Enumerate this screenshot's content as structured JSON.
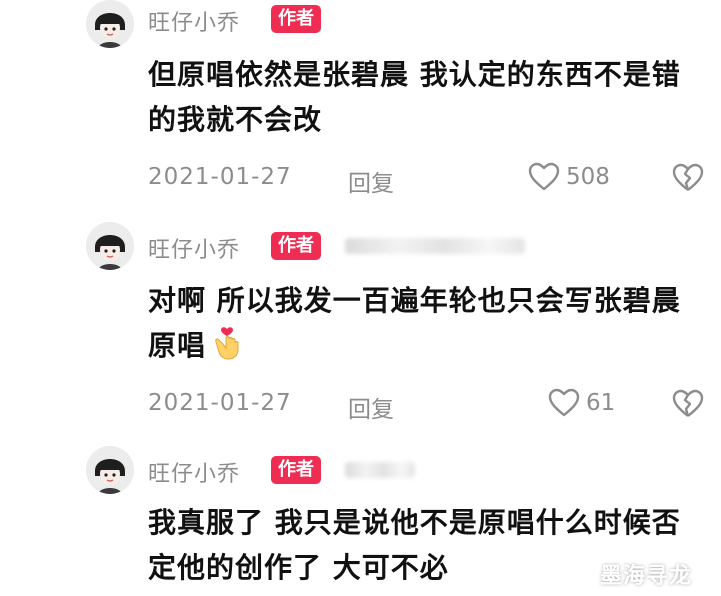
{
  "comments": [
    {
      "author": "旺仔小乔",
      "badge": "作者",
      "text": "但原唱依然是张碧晨 我认定的东西不是错的我就不会改",
      "date": "2021-01-27",
      "reply_label": "回复",
      "likes": "508"
    },
    {
      "author": "旺仔小乔",
      "badge": "作者",
      "text": "对啊 所以我发一百遍年轮也只会写张碧晨原唱",
      "date": "2021-01-27",
      "reply_label": "回复",
      "likes": "61"
    },
    {
      "author": "旺仔小乔",
      "badge": "作者",
      "text": "我真服了 我只是说他不是原唱什么时候否定他的创作了 大可不必"
    }
  ],
  "watermark": "墨海寻龙",
  "colors": {
    "badge": "#ef2d52",
    "meta_text": "#8c8c8c",
    "body_text": "#111111"
  },
  "icons": [
    "avatar",
    "heart-icon",
    "broken-heart-icon",
    "heart-hands-emoji"
  ]
}
